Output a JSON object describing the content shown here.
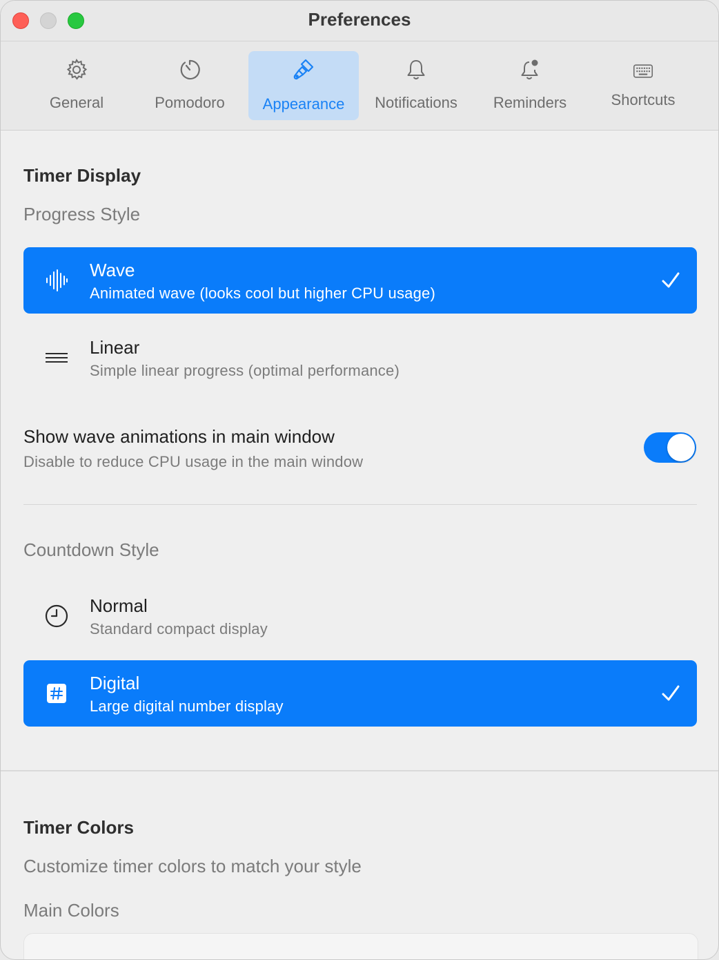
{
  "window": {
    "title": "Preferences"
  },
  "toolbar": {
    "tabs": [
      {
        "label": "General",
        "icon": "gear-icon"
      },
      {
        "label": "Pomodoro",
        "icon": "timer-icon"
      },
      {
        "label": "Appearance",
        "icon": "paintbrush-icon",
        "active": true
      },
      {
        "label": "Notifications",
        "icon": "bell-icon"
      },
      {
        "label": "Reminders",
        "icon": "bell-badge-icon"
      },
      {
        "label": "Shortcuts",
        "icon": "keyboard-icon"
      }
    ]
  },
  "timer_display": {
    "heading": "Timer Display",
    "progress_style_label": "Progress Style",
    "progress_options": [
      {
        "title": "Wave",
        "desc": "Animated wave (looks cool but higher CPU usage)",
        "icon": "waveform-icon",
        "selected": true
      },
      {
        "title": "Linear",
        "desc": "Simple linear progress (optimal performance)",
        "icon": "lines-icon",
        "selected": false
      }
    ],
    "wave_toggle": {
      "title": "Show wave animations in main window",
      "desc": "Disable to reduce CPU usage in the main window",
      "on": true
    },
    "countdown_style_label": "Countdown Style",
    "countdown_options": [
      {
        "title": "Normal",
        "desc": "Standard compact display",
        "icon": "clock-icon",
        "selected": false
      },
      {
        "title": "Digital",
        "desc": "Large digital number display",
        "icon": "number-icon",
        "selected": true
      }
    ]
  },
  "timer_colors": {
    "heading": "Timer Colors",
    "subtitle": "Customize timer colors to match your style",
    "main_colors_label": "Main Colors"
  },
  "colors": {
    "accent": "#0a7cfa",
    "tab_active_bg": "#c4dcf6"
  }
}
